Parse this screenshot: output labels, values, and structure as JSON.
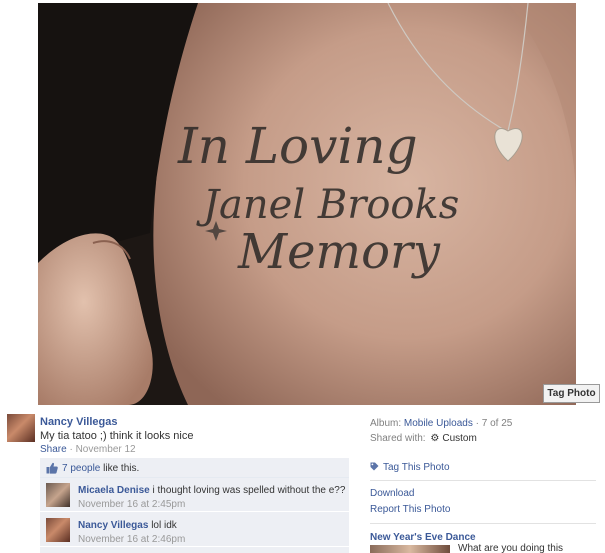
{
  "photo": {
    "tattoo_lines": [
      "In Loving",
      "Janel Brooks",
      "Memory"
    ],
    "tag_photo_button": "Tag Photo"
  },
  "post": {
    "author": "Nancy Villegas",
    "caption": "My tia tatoo ;) think it looks nice",
    "share_label": "Share",
    "separator": " · ",
    "date": "November 12"
  },
  "likes": {
    "count_link": "7 people",
    "suffix": " like this."
  },
  "comments": [
    {
      "author": "Micaela Denise",
      "text": "i thought loving was spelled without the e??",
      "time": "November 16 at 2:45pm"
    },
    {
      "author": "Nancy Villegas",
      "text": "lol idk",
      "time": "November 16 at 2:46pm"
    }
  ],
  "sidebar": {
    "album_label": "Album:",
    "album_name": "Mobile Uploads",
    "album_position": "· 7 of 25",
    "shared_label": "Shared with:",
    "shared_icon": "gear-icon",
    "shared_value": "Custom",
    "tag_this_photo": "Tag This Photo",
    "download": "Download",
    "report": "Report This Photo",
    "event_title": "New Year's Eve Dance",
    "event_text": "What are you doing this"
  },
  "colors": {
    "link": "#3b5998",
    "ufi_bg": "#edeff4",
    "meta": "#999999"
  }
}
